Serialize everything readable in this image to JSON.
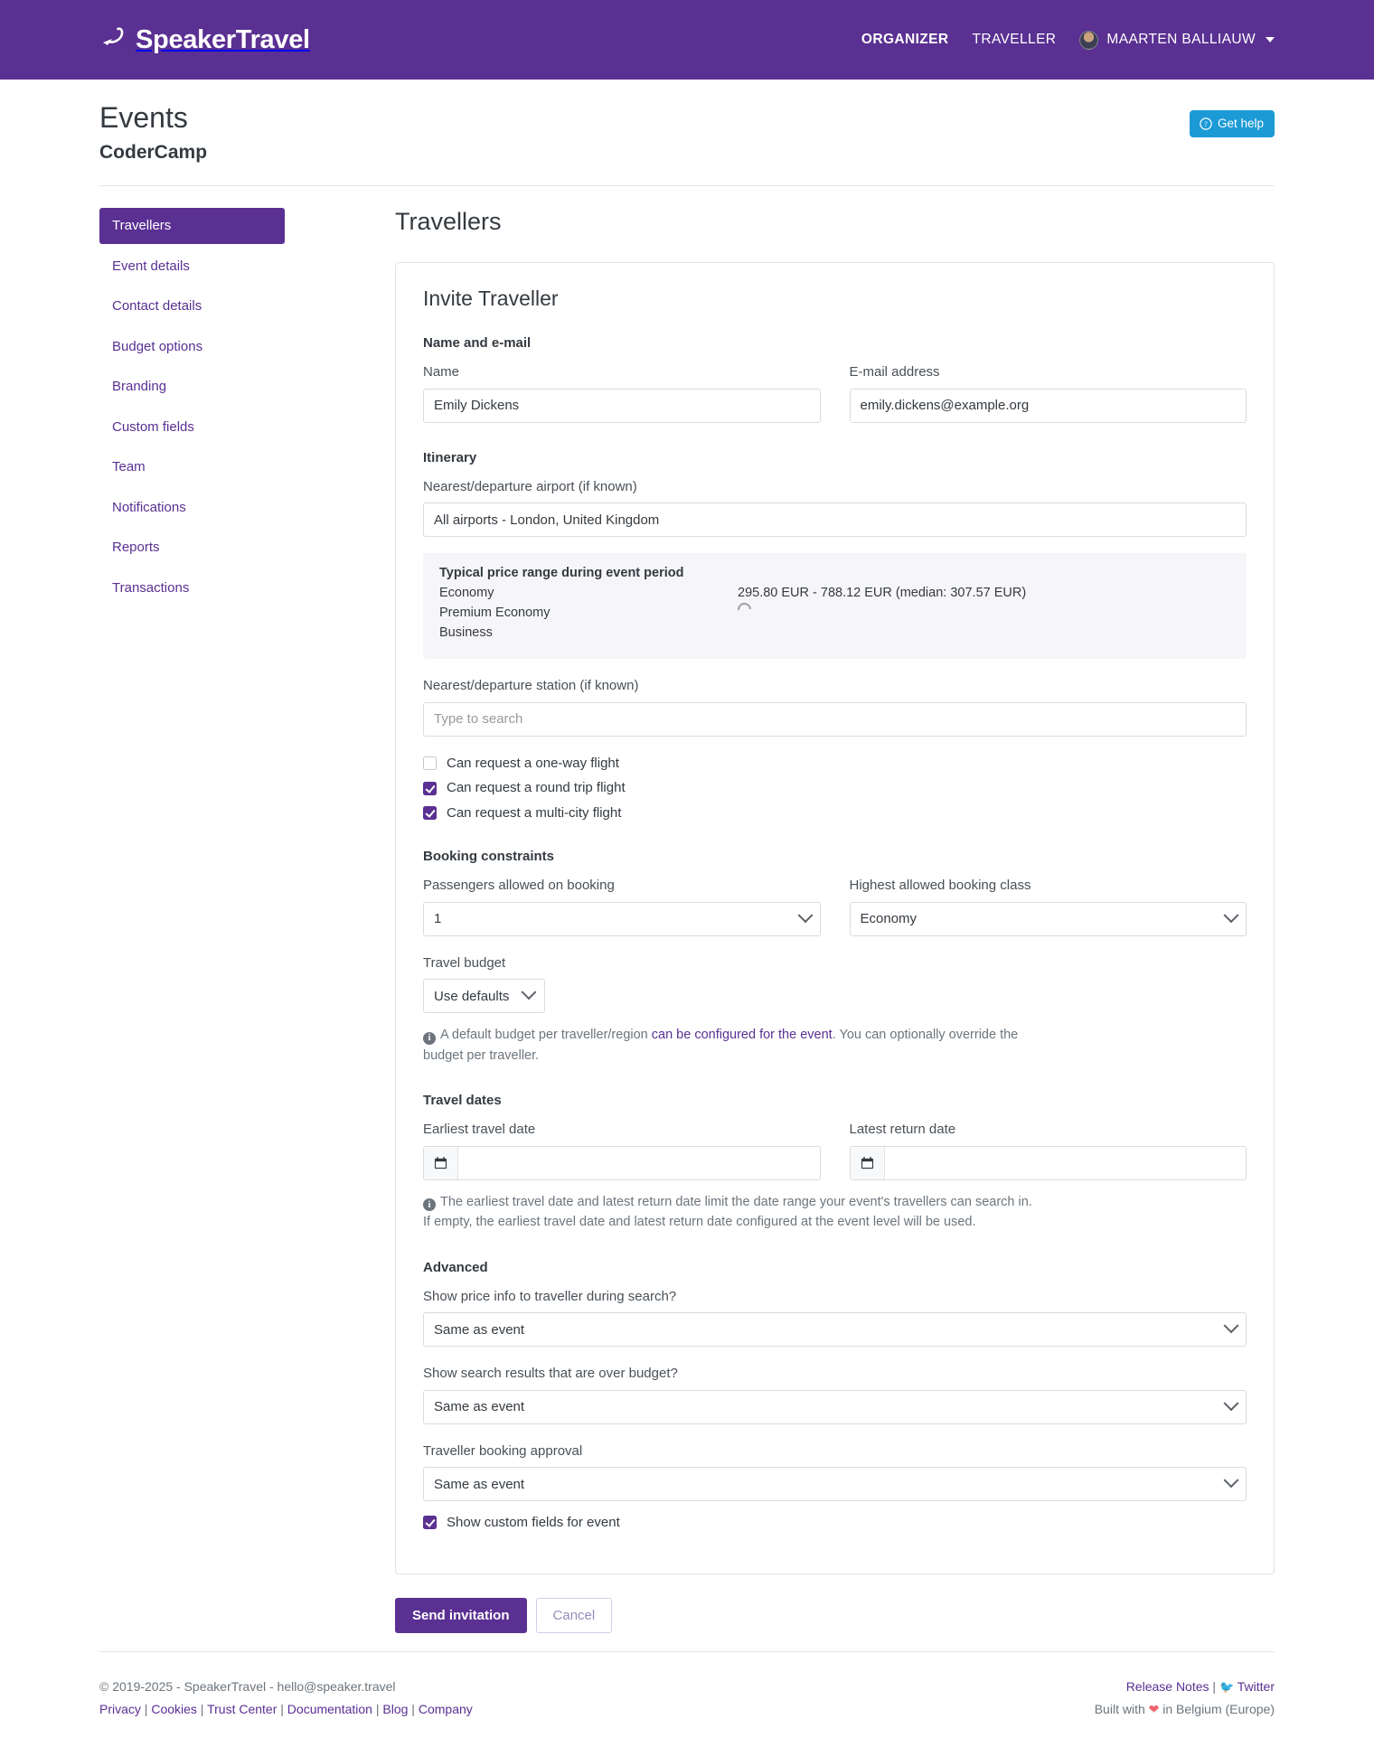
{
  "navbar": {
    "brand": "SpeakerTravel",
    "brand_logo_icon": "airplane-icon",
    "links": [
      {
        "label": "ORGANIZER",
        "active": true
      },
      {
        "label": "TRAVELLER",
        "active": false
      }
    ],
    "user": {
      "name": "MAARTEN BALLIAUW",
      "avatar_icon": "user-avatar",
      "caret_icon": "caret-down-icon"
    },
    "brand_color": "#5a3092"
  },
  "header": {
    "title": "Events",
    "subtitle": "CoderCamp",
    "get_help": {
      "label": "Get help",
      "icon": "question-circle-icon",
      "color": "#1b9ad6"
    }
  },
  "sidebar": {
    "items": [
      {
        "label": "Travellers",
        "active": true
      },
      {
        "label": "Event details",
        "active": false
      },
      {
        "label": "Contact details",
        "active": false
      },
      {
        "label": "Budget options",
        "active": false
      },
      {
        "label": "Branding",
        "active": false
      },
      {
        "label": "Custom fields",
        "active": false
      },
      {
        "label": "Team",
        "active": false
      },
      {
        "label": "Notifications",
        "active": false
      },
      {
        "label": "Reports",
        "active": false
      },
      {
        "label": "Transactions",
        "active": false
      }
    ]
  },
  "main": {
    "title": "Travellers",
    "card_title": "Invite Traveller",
    "sections": {
      "name_email": {
        "heading": "Name and e-mail",
        "name_label": "Name",
        "name_value": "Emily Dickens",
        "email_label": "E-mail address",
        "email_value": "emily.dickens@example.org"
      },
      "itinerary": {
        "heading": "Itinerary",
        "airport_label": "Nearest/departure airport (if known)",
        "airport_value": "All airports - London, United Kingdom",
        "price_panel": {
          "heading": "Typical price range during event period",
          "rows": [
            {
              "class": "Economy",
              "value": "295.80 EUR - 788.12 EUR (median: 307.57 EUR)",
              "loading": false
            },
            {
              "class": "Premium Economy",
              "value": "",
              "loading": true
            },
            {
              "class": "Business",
              "value": "",
              "loading": false
            }
          ]
        },
        "station_label": "Nearest/departure station (if known)",
        "station_value": "",
        "station_placeholder": "Type to search",
        "checkboxes": [
          {
            "label": "Can request a one-way flight",
            "checked": false
          },
          {
            "label": "Can request a round trip flight",
            "checked": true
          },
          {
            "label": "Can request a multi-city flight",
            "checked": true
          }
        ]
      },
      "booking_constraints": {
        "heading": "Booking constraints",
        "passengers_label": "Passengers allowed on booking",
        "passengers_value": "1",
        "class_label": "Highest allowed booking class",
        "class_value": "Economy",
        "budget_label": "Travel budget",
        "budget_value": "Use defaults",
        "note_before_link": "A default budget per traveller/region ",
        "note_link": "can be configured for the event",
        "note_after_link": ". You can optionally override the budget per traveller."
      },
      "travel_dates": {
        "heading": "Travel dates",
        "earliest_label": "Earliest travel date",
        "earliest_value": "",
        "latest_label": "Latest return date",
        "latest_value": "",
        "calendar_icon": "calendar-icon",
        "note": "The earliest travel date and latest return date limit the date range your event's travellers can search in. If empty, the earliest travel date and latest return date configured at the event level will be used."
      },
      "advanced": {
        "heading": "Advanced",
        "price_info_label": "Show price info to traveller during search?",
        "price_info_value": "Same as event",
        "over_budget_label": "Show search results that are over budget?",
        "over_budget_value": "Same as event",
        "approval_label": "Traveller booking approval",
        "approval_value": "Same as event",
        "custom_fields_checkbox": {
          "label": "Show custom fields for event",
          "checked": true
        }
      }
    },
    "actions": {
      "submit": "Send invitation",
      "cancel": "Cancel"
    }
  },
  "footer": {
    "copyright": "© 2019-2025 - SpeakerTravel - hello@speaker.travel",
    "links": [
      "Privacy",
      "Cookies",
      "Trust Center",
      "Documentation",
      "Blog",
      "Company"
    ],
    "release_notes": "Release Notes",
    "twitter": "Twitter",
    "twitter_icon": "twitter-bird-icon",
    "built_with_prefix": "Built with ",
    "heart_icon": "heart-icon",
    "built_with_suffix": " in Belgium (Europe)"
  }
}
